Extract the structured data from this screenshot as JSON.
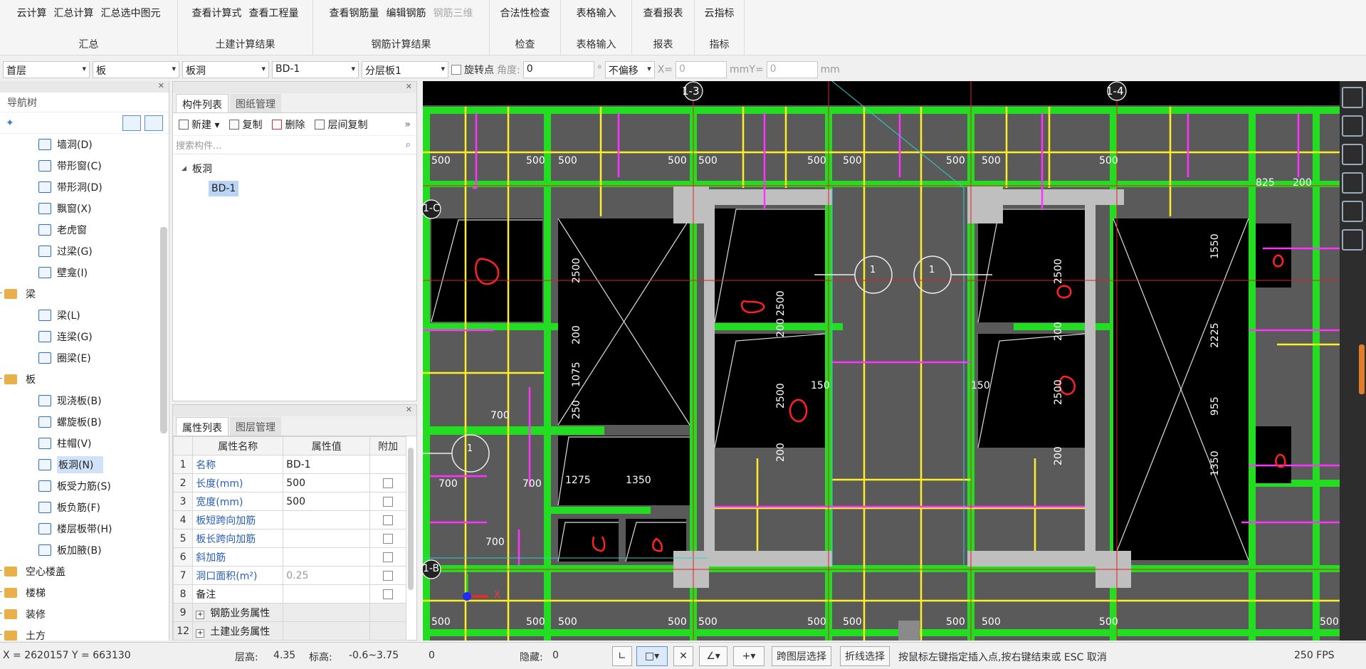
{
  "ribbon": {
    "groups": [
      {
        "name": "汇总",
        "buttons": [
          "云计算",
          "汇总计算",
          "汇总选中图元"
        ]
      },
      {
        "name": "土建计算结果",
        "buttons": [
          "查看计算式",
          "查看工程量"
        ]
      },
      {
        "name": "钢筋计算结果",
        "buttons": [
          "查看钢筋量",
          "编辑钢筋",
          "钢筋三维"
        ]
      },
      {
        "name": "检查",
        "buttons": [
          "合法性检查"
        ]
      },
      {
        "name": "表格输入",
        "buttons": [
          "表格输入"
        ]
      },
      {
        "name": "报表",
        "buttons": [
          "查看报表"
        ]
      },
      {
        "name": "指标",
        "buttons": [
          "云指标"
        ]
      }
    ]
  },
  "toolbar": {
    "floor": "首层",
    "category": "板",
    "type": "板洞",
    "component": "BD-1",
    "layer": "分层板1",
    "rotate_label": "旋转点",
    "angle_label": "角度:",
    "angle_value": "0",
    "offset_mode": "不偏移",
    "x_label": "X=",
    "x_value": "0",
    "y_label": "mmY=",
    "y_value": "0",
    "mm_label": "mm"
  },
  "nav": {
    "title": "导航树",
    "items": [
      {
        "label": "墙洞(D)",
        "kind": "child"
      },
      {
        "label": "带形窗(C)",
        "kind": "child"
      },
      {
        "label": "带形洞(D)",
        "kind": "child"
      },
      {
        "label": "飘窗(X)",
        "kind": "child"
      },
      {
        "label": "老虎窗",
        "kind": "child"
      },
      {
        "label": "过梁(G)",
        "kind": "child"
      },
      {
        "label": "壁龛(I)",
        "kind": "child"
      },
      {
        "label": "梁",
        "kind": "cat"
      },
      {
        "label": "梁(L)",
        "kind": "child"
      },
      {
        "label": "连梁(G)",
        "kind": "child"
      },
      {
        "label": "圈梁(E)",
        "kind": "child"
      },
      {
        "label": "板",
        "kind": "cat"
      },
      {
        "label": "现浇板(B)",
        "kind": "child"
      },
      {
        "label": "螺旋板(B)",
        "kind": "child"
      },
      {
        "label": "柱帽(V)",
        "kind": "child"
      },
      {
        "label": "板洞(N)",
        "kind": "child",
        "selected": true
      },
      {
        "label": "板受力筋(S)",
        "kind": "child"
      },
      {
        "label": "板负筋(F)",
        "kind": "child"
      },
      {
        "label": "楼层板带(H)",
        "kind": "child"
      },
      {
        "label": "板加腋(B)",
        "kind": "child"
      },
      {
        "label": "空心楼盖",
        "kind": "cat"
      },
      {
        "label": "楼梯",
        "kind": "cat"
      },
      {
        "label": "装修",
        "kind": "cat"
      },
      {
        "label": "土方",
        "kind": "cat"
      }
    ]
  },
  "list_panel": {
    "tabs": [
      "构件列表",
      "图纸管理"
    ],
    "tools": [
      "新建",
      "复制",
      "删除",
      "层间复制"
    ],
    "search_placeholder": "搜索构件...",
    "group": "板洞",
    "item": "BD-1"
  },
  "prop_panel": {
    "tabs": [
      "属性列表",
      "图层管理"
    ],
    "headers": [
      "属性名称",
      "属性值",
      "附加"
    ],
    "rows": [
      {
        "idx": "1",
        "name": "名称",
        "value": "BD-1",
        "check": false
      },
      {
        "idx": "2",
        "name": "长度(mm)",
        "value": "500",
        "check": true
      },
      {
        "idx": "3",
        "name": "宽度(mm)",
        "value": "500",
        "check": true
      },
      {
        "idx": "4",
        "name": "板短跨向加筋",
        "value": "",
        "check": true
      },
      {
        "idx": "5",
        "name": "板长跨向加筋",
        "value": "",
        "check": true
      },
      {
        "idx": "6",
        "name": "斜加筋",
        "value": "",
        "check": true
      },
      {
        "idx": "7",
        "name": "洞口面积(m²)",
        "value": "0.25",
        "check": true
      },
      {
        "idx": "8",
        "name": "备注",
        "value": "",
        "check": true
      },
      {
        "idx": "9",
        "name": "钢筋业务属性",
        "value": "",
        "check": false,
        "group": true
      },
      {
        "idx": "12",
        "name": "土建业务属性",
        "value": "",
        "check": false,
        "group": true
      }
    ]
  },
  "cad": {
    "axis_labels": [
      "1-3",
      "1-4",
      "1-C",
      "1-B"
    ],
    "dims_top": [
      "500",
      "500",
      "500",
      "500",
      "500",
      "500",
      "500",
      "500",
      "500",
      "500"
    ],
    "dims_bottom": [
      "500",
      "500",
      "500",
      "500",
      "500",
      "500",
      "500",
      "500",
      "500",
      "500",
      "500"
    ],
    "dims_vertical": [
      "2500",
      "200",
      "1075",
      "250",
      "2500",
      "200",
      "2500",
      "200",
      "2500",
      "200",
      "2500",
      "200",
      "1550",
      "2225",
      "955",
      "1350"
    ],
    "dims_horizontal": [
      "1275",
      "1350",
      "150",
      "150",
      "700",
      "700",
      "700",
      "825",
      "200",
      "700"
    ],
    "circle_marks": [
      "1",
      "1",
      "1"
    ],
    "axis_indicator": "X",
    "colors": {
      "beam": "#22dd22",
      "slab": "#5a5a5a",
      "rebar": "#ffee22",
      "neg_rebar": "#ff33ff",
      "hole": "#000000",
      "grid": "#dd2222",
      "column": "#bfbfbf",
      "annotation": "#ff2222"
    }
  },
  "status": {
    "coords": "X = 2620157 Y = 663130",
    "floor_height_label": "层高:",
    "floor_height": "4.35",
    "elev_label": "标高:",
    "elev": "-0.6~3.75",
    "count": "0",
    "hidden_label": "隐藏:",
    "hidden": "0",
    "btn_cross_floor": "跨图层选择",
    "btn_polyline": "折线选择",
    "hint": "按鼠标左键指定插入点,按右键结束或 ESC 取消",
    "fps": "250 FPS"
  }
}
